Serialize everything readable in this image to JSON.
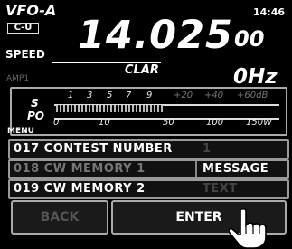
{
  "header": {
    "vfo": "VFO-A",
    "mode_badge": "C-U",
    "clock": "14:46",
    "speed_label": "SPEED",
    "frequency_main": "14.025",
    "frequency_small": "00"
  },
  "clar": {
    "label": "CLAR",
    "value": "0Hz"
  },
  "amp_label": "AMP1",
  "meter": {
    "s_label": "S",
    "po_label": "PO",
    "s_scale": [
      "1",
      "3",
      "5",
      "7",
      "9",
      "+20",
      "+40",
      "+60dB"
    ],
    "po_scale": [
      "0",
      "10",
      "50",
      "100",
      "150W"
    ]
  },
  "menu": {
    "label": "MENU",
    "rows": [
      {
        "title": "017 CONTEST NUMBER",
        "value": "1"
      },
      {
        "title": "018 CW MEMORY 1",
        "value": "MESSAGE"
      },
      {
        "title": "019 CW MEMORY 2",
        "value": "TEXT"
      }
    ]
  },
  "buttons": {
    "back": "BACK",
    "enter": "ENTER"
  },
  "colors": {
    "background": "#000000",
    "text": "#ffffff",
    "dim_text": "#555555"
  }
}
